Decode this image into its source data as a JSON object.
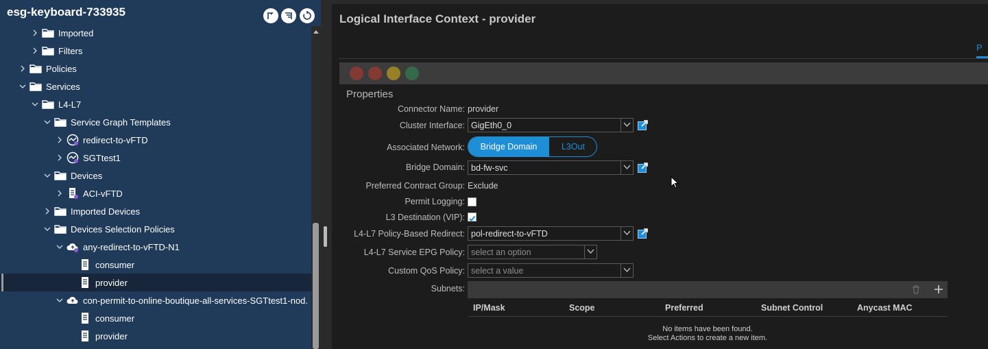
{
  "left_panel": {
    "tenant_title": "esg-keyboard-733935",
    "tree": [
      {
        "label": "Imported",
        "icon": "folder-icon",
        "chevron": "right"
      },
      {
        "label": "Filters",
        "icon": "folder-icon",
        "chevron": "right"
      },
      {
        "label": "Policies",
        "icon": "folder-icon",
        "chevron": "right"
      },
      {
        "label": "Services",
        "icon": "folder-icon",
        "chevron": "down"
      },
      {
        "label": "L4-L7",
        "icon": "folder-icon",
        "chevron": "down"
      },
      {
        "label": "Service Graph Templates",
        "icon": "folder-icon",
        "chevron": "down"
      },
      {
        "label": "redirect-to-vFTD",
        "icon": "service-graph-icon",
        "chevron": "right"
      },
      {
        "label": "SGTtest1",
        "icon": "service-graph-icon",
        "chevron": "right"
      },
      {
        "label": "Devices",
        "icon": "folder-icon",
        "chevron": "down"
      },
      {
        "label": "ACI-vFTD",
        "icon": "device-icon",
        "chevron": "right"
      },
      {
        "label": "Imported Devices",
        "icon": "folder-icon",
        "chevron": "right"
      },
      {
        "label": "Devices Selection Policies",
        "icon": "folder-icon",
        "chevron": "down"
      },
      {
        "label": "any-redirect-to-vFTD-N1",
        "icon": "cloud-policy-icon",
        "chevron": "down"
      },
      {
        "label": "consumer",
        "icon": "document-icon",
        "chevron": "none"
      },
      {
        "label": "provider",
        "icon": "document-icon",
        "chevron": "none"
      },
      {
        "label": "con-permit-to-online-boutique-all-services-SGTtest1-nod.",
        "icon": "cloud-icon",
        "chevron": "down"
      },
      {
        "label": "consumer",
        "icon": "document-icon",
        "chevron": "none"
      },
      {
        "label": "provider",
        "icon": "document-icon",
        "chevron": "none"
      }
    ]
  },
  "right_panel": {
    "title": "Logical Interface Context - provider",
    "tab_fragment": "P",
    "properties_title": "Properties",
    "fields": {
      "connector_name": {
        "label": "Connector Name:",
        "value": "provider"
      },
      "cluster_interface": {
        "label": "Cluster Interface:",
        "value": "GigEth0_0"
      },
      "associated_network": {
        "label": "Associated Network:",
        "options": [
          "Bridge Domain",
          "L3Out"
        ],
        "selected": "Bridge Domain"
      },
      "bridge_domain": {
        "label": "Bridge Domain:",
        "value": "bd-fw-svc"
      },
      "preferred_contract_group": {
        "label": "Preferred Contract Group:",
        "value": "Exclude"
      },
      "permit_logging": {
        "label": "Permit Logging:",
        "checked": false
      },
      "l3_destination": {
        "label": "L3 Destination (VIP):",
        "checked": true
      },
      "pbr": {
        "label": "L4-L7 Policy-Based Redirect:",
        "value": "pol-redirect-to-vFTD"
      },
      "service_epg_policy": {
        "label": "L4-L7 Service EPG Policy:",
        "placeholder": "select an option"
      },
      "custom_qos": {
        "label": "Custom QoS Policy:",
        "placeholder": "select a value"
      },
      "subnets": {
        "label": "Subnets:"
      }
    },
    "subnets_table": {
      "columns": [
        "IP/Mask",
        "Scope",
        "Preferred",
        "Subnet Control",
        "Anycast MAC"
      ],
      "empty_line1": "No items have been found.",
      "empty_line2": "Select Actions to create a new item."
    }
  },
  "colors": {
    "accent_blue": "#1e8fd6",
    "tree_bg": "#203a5a",
    "fault_critical": "#c0392b",
    "fault_major": "#e67e22",
    "fault_minor": "#f1c40f",
    "fault_warning": "#27ae60"
  }
}
